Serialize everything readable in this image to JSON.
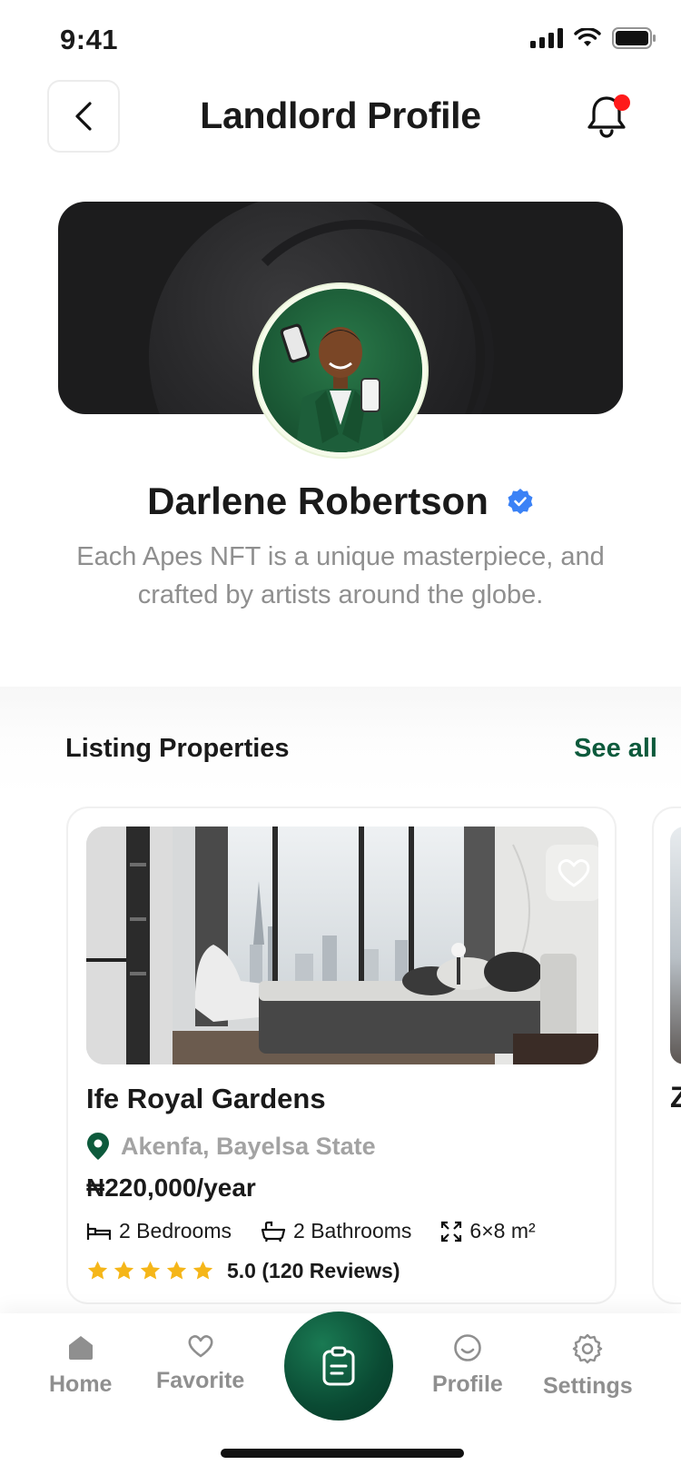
{
  "status_bar": {
    "time": "9:41"
  },
  "header": {
    "title": "Landlord Profile"
  },
  "profile": {
    "name": "Darlene Robertson",
    "bio": "Each Apes NFT is a unique masterpiece, and crafted by artists around the globe."
  },
  "listing": {
    "section_title": "Listing Properties",
    "see_all": "See all",
    "cards": [
      {
        "name": "Ife Royal Gardens",
        "location": "Akenfa, Bayelsa State",
        "price": "₦220,000/year",
        "bedrooms": "2 Bedrooms",
        "bathrooms": "2 Bathrooms",
        "size": "6×8 m²",
        "rating_value": 5,
        "rating_text": "5.0 (120 Reviews)"
      }
    ],
    "peek_initial": "Z"
  },
  "nav": {
    "items": [
      {
        "label": "Home",
        "icon": "home-icon"
      },
      {
        "label": "Favorite",
        "icon": "heart-icon"
      },
      {
        "label": "Profile",
        "icon": "smile-icon"
      },
      {
        "label": "Settings",
        "icon": "gear-icon"
      }
    ],
    "center_icon": "clipboard-icon"
  },
  "colors": {
    "accent": "#0d5a3c",
    "star": "#f5b619",
    "notification": "#ff1a1a",
    "verified": "#3b82f6"
  }
}
